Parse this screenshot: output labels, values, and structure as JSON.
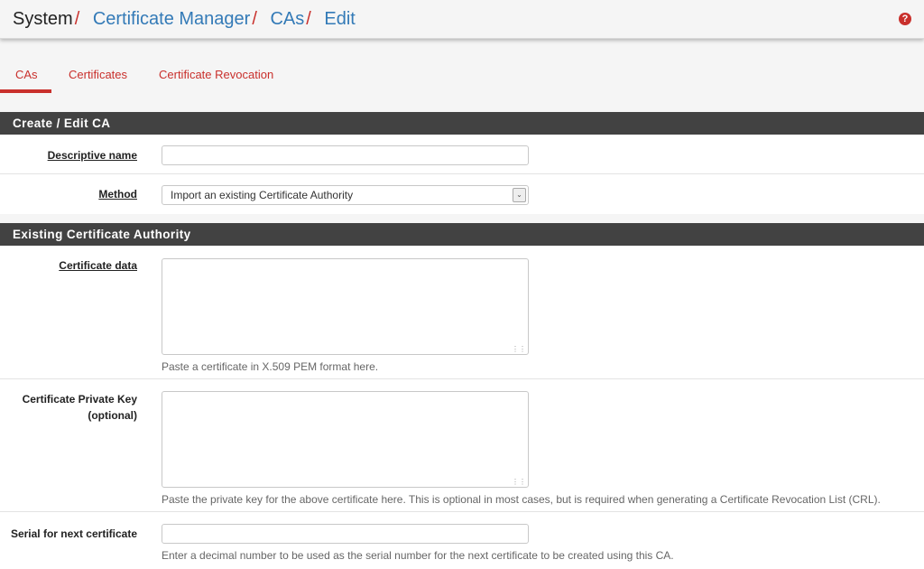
{
  "breadcrumb": {
    "root": "System",
    "separator": "/",
    "items": [
      "Certificate Manager",
      "CAs",
      "Edit"
    ]
  },
  "help_icon": "?",
  "tabs": [
    {
      "label": "CAs",
      "active": true
    },
    {
      "label": "Certificates",
      "active": false
    },
    {
      "label": "Certificate Revocation",
      "active": false
    }
  ],
  "sections": {
    "create": {
      "title": "Create / Edit CA",
      "descriptive_name_label": "Descriptive name",
      "descriptive_name_value": "",
      "method_label": "Method",
      "method_value": "Import an existing Certificate Authority"
    },
    "existing": {
      "title": "Existing Certificate Authority",
      "cert_data_label": "Certificate data",
      "cert_data_help": "Paste a certificate in X.509 PEM format here.",
      "private_key_label_line1": "Certificate Private Key",
      "private_key_label_line2": "(optional)",
      "private_key_help": "Paste the private key for the above certificate here. This is optional in most cases, but is required when generating a Certificate Revocation List (CRL).",
      "serial_label": "Serial for next certificate",
      "serial_value": "",
      "serial_help": "Enter a decimal number to be used as the serial number for the next certificate to be created using this CA."
    }
  },
  "colors": {
    "accent_red": "#c9302c",
    "link_blue": "#337ab7",
    "panel_header": "#424242"
  }
}
